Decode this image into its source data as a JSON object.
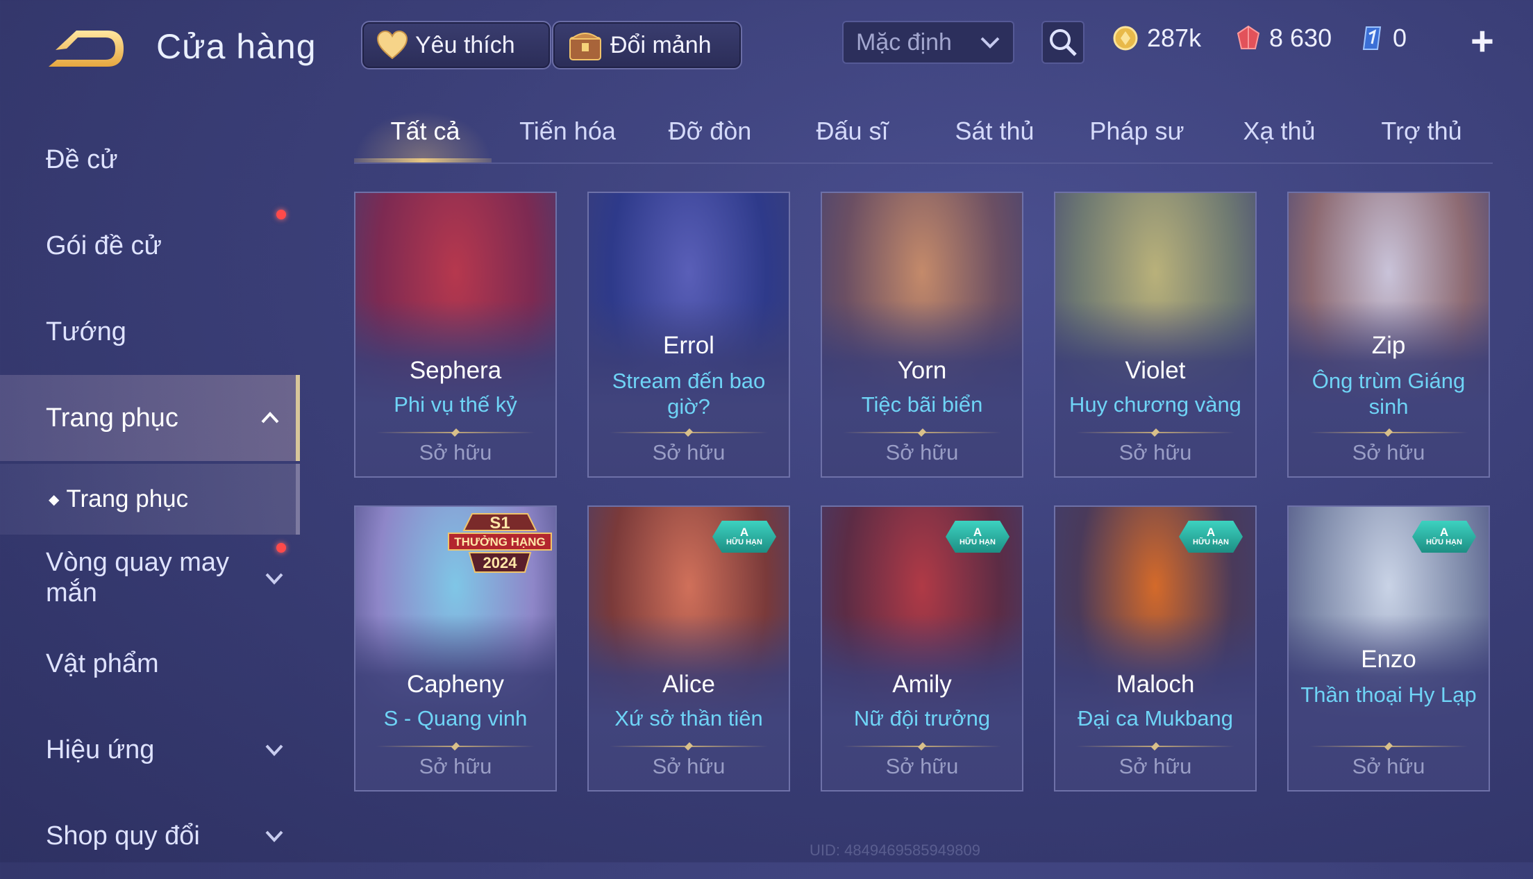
{
  "header": {
    "title": "Cửa hàng",
    "favorites_label": "Yêu thích",
    "shard_exchange_label": "Đổi mảnh",
    "sort_value": "Mặc định",
    "currencies": {
      "gold": "287k",
      "vouchers": "8 630",
      "crystals": "0"
    }
  },
  "sidebar": {
    "items": [
      {
        "label": "Đề cử"
      },
      {
        "label": "Gói đề cử"
      },
      {
        "label": "Tướng"
      },
      {
        "label": "Trang phục"
      },
      {
        "label": "Trang phục"
      },
      {
        "label": "Vòng quay may mắn"
      },
      {
        "label": "Vật phẩm"
      },
      {
        "label": "Hiệu ứng"
      },
      {
        "label": "Shop quy đổi"
      }
    ]
  },
  "tabs": [
    {
      "label": "Tất cả"
    },
    {
      "label": "Tiến hóa"
    },
    {
      "label": "Đỡ đòn"
    },
    {
      "label": "Đấu sĩ"
    },
    {
      "label": "Sát thủ"
    },
    {
      "label": "Pháp sư"
    },
    {
      "label": "Xạ thủ"
    },
    {
      "label": "Trợ thủ"
    }
  ],
  "skins": [
    {
      "hero": "Sephera",
      "skin": "Phi vụ thế kỷ",
      "status": "Sở hữu",
      "palette": [
        "#b6384e",
        "#7d2a52"
      ]
    },
    {
      "hero": "Errol",
      "skin": "Stream đến bao giờ?",
      "status": "Sở hữu",
      "palette": [
        "#5a5fb8",
        "#2e3a8a"
      ]
    },
    {
      "hero": "Yorn",
      "skin": "Tiệc bãi biển",
      "status": "Sở hữu",
      "palette": [
        "#c48a6a",
        "#6b4f63"
      ]
    },
    {
      "hero": "Violet",
      "skin": "Huy chương vàng",
      "status": "Sở hữu",
      "palette": [
        "#b9b17a",
        "#6f7a72"
      ]
    },
    {
      "hero": "Zip",
      "skin": "Ông trùm Giáng sinh",
      "status": "Sở hữu",
      "palette": [
        "#c9c3d9",
        "#8d6a72"
      ]
    },
    {
      "hero": "Capheny",
      "skin": "S - Quang vinh",
      "status": "Sở hữu",
      "palette": [
        "#7fc6e6",
        "#8e86c8"
      ],
      "badge_line1": "S1",
      "badge_line2": "THƯỞNG HẠNG",
      "badge_line3": "2024"
    },
    {
      "hero": "Alice",
      "skin": "Xứ sở thần tiên",
      "status": "Sở hữu",
      "palette": [
        "#d0705a",
        "#7a3a3a"
      ],
      "badge_grade": "A",
      "badge_text": "HỮU HẠN"
    },
    {
      "hero": "Amily",
      "skin": "Nữ đội trưởng",
      "status": "Sở hữu",
      "palette": [
        "#b03a46",
        "#5c2c45"
      ],
      "badge_grade": "A",
      "badge_text": "HỮU HẠN"
    },
    {
      "hero": "Maloch",
      "skin": "Đại ca Mukbang",
      "status": "Sở hữu",
      "palette": [
        "#d46a2a",
        "#4a3a5a"
      ],
      "badge_grade": "A",
      "badge_text": "HỮU HẠN"
    },
    {
      "hero": "Enzo",
      "skin": "Thần thoại Hy Lạp",
      "status": "Sở hữu",
      "palette": [
        "#c9d3e6",
        "#7c88a8"
      ],
      "badge_grade": "A",
      "badge_text": "HỮU HẠN"
    }
  ],
  "footer": {
    "uid": "UID: 4849469585949809"
  }
}
